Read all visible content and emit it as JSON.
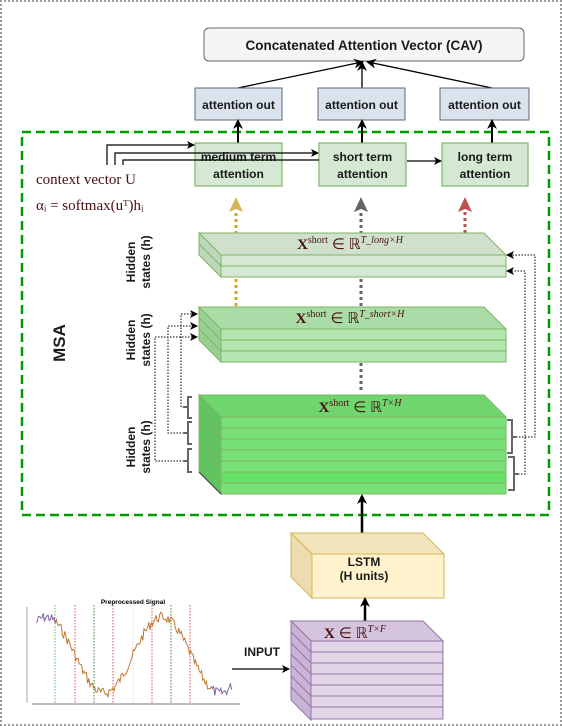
{
  "title": "Concatenated Attention Vector (CAV)",
  "attention_outputs": [
    "attention out",
    "attention out",
    "attention out"
  ],
  "attention_blocks": [
    {
      "line1": "medium term",
      "line2": "attention",
      "arrow_color": "#d6b656"
    },
    {
      "line1": "short term",
      "line2": "attention",
      "arrow_color": "#666666"
    },
    {
      "line1": "long term",
      "line2": "attention",
      "arrow_color": "#b85450"
    }
  ],
  "context": {
    "line1": "context vector U",
    "line2": "αᵢ = softmax(uᵀ)hᵢ"
  },
  "msa_label": "MSA",
  "hidden_label": {
    "line1": "Hidden",
    "line2": "states (h)"
  },
  "tensors": {
    "long": {
      "base": "X",
      "sup": "short",
      "rel": "∈ ℝ",
      "exp": "T_long×H"
    },
    "short": {
      "base": "X",
      "sup": "short",
      "rel": "∈ ℝ",
      "exp": "T_short×H"
    },
    "full": {
      "base": "X",
      "sup": "short",
      "rel": "∈ ℝ",
      "exp": "T×H"
    },
    "input": {
      "base": "X",
      "rel": "∈ ℝ",
      "exp": "T×F"
    }
  },
  "lstm": {
    "line1": "LSTM",
    "line2": "(H units)"
  },
  "input_label": "INPUT",
  "signal_plot": {
    "title": "Preprocessed Signal"
  },
  "colors": {
    "msa_border": "#009900",
    "attention_out_fill": "#dae3eb",
    "attention_out_stroke": "#5a6b7b",
    "attention_fill": "#d5e8d4",
    "attention_stroke": "#82b366",
    "tensor_long_fill": "#d5e8d4",
    "tensor_short_fill": "#b3e6b0",
    "tensor_full_fill": "#77e077",
    "lstm_fill": "#fff2cc",
    "lstm_stroke": "#d6b656",
    "input_fill": "#e1d5e7",
    "input_stroke": "#9673a6"
  }
}
